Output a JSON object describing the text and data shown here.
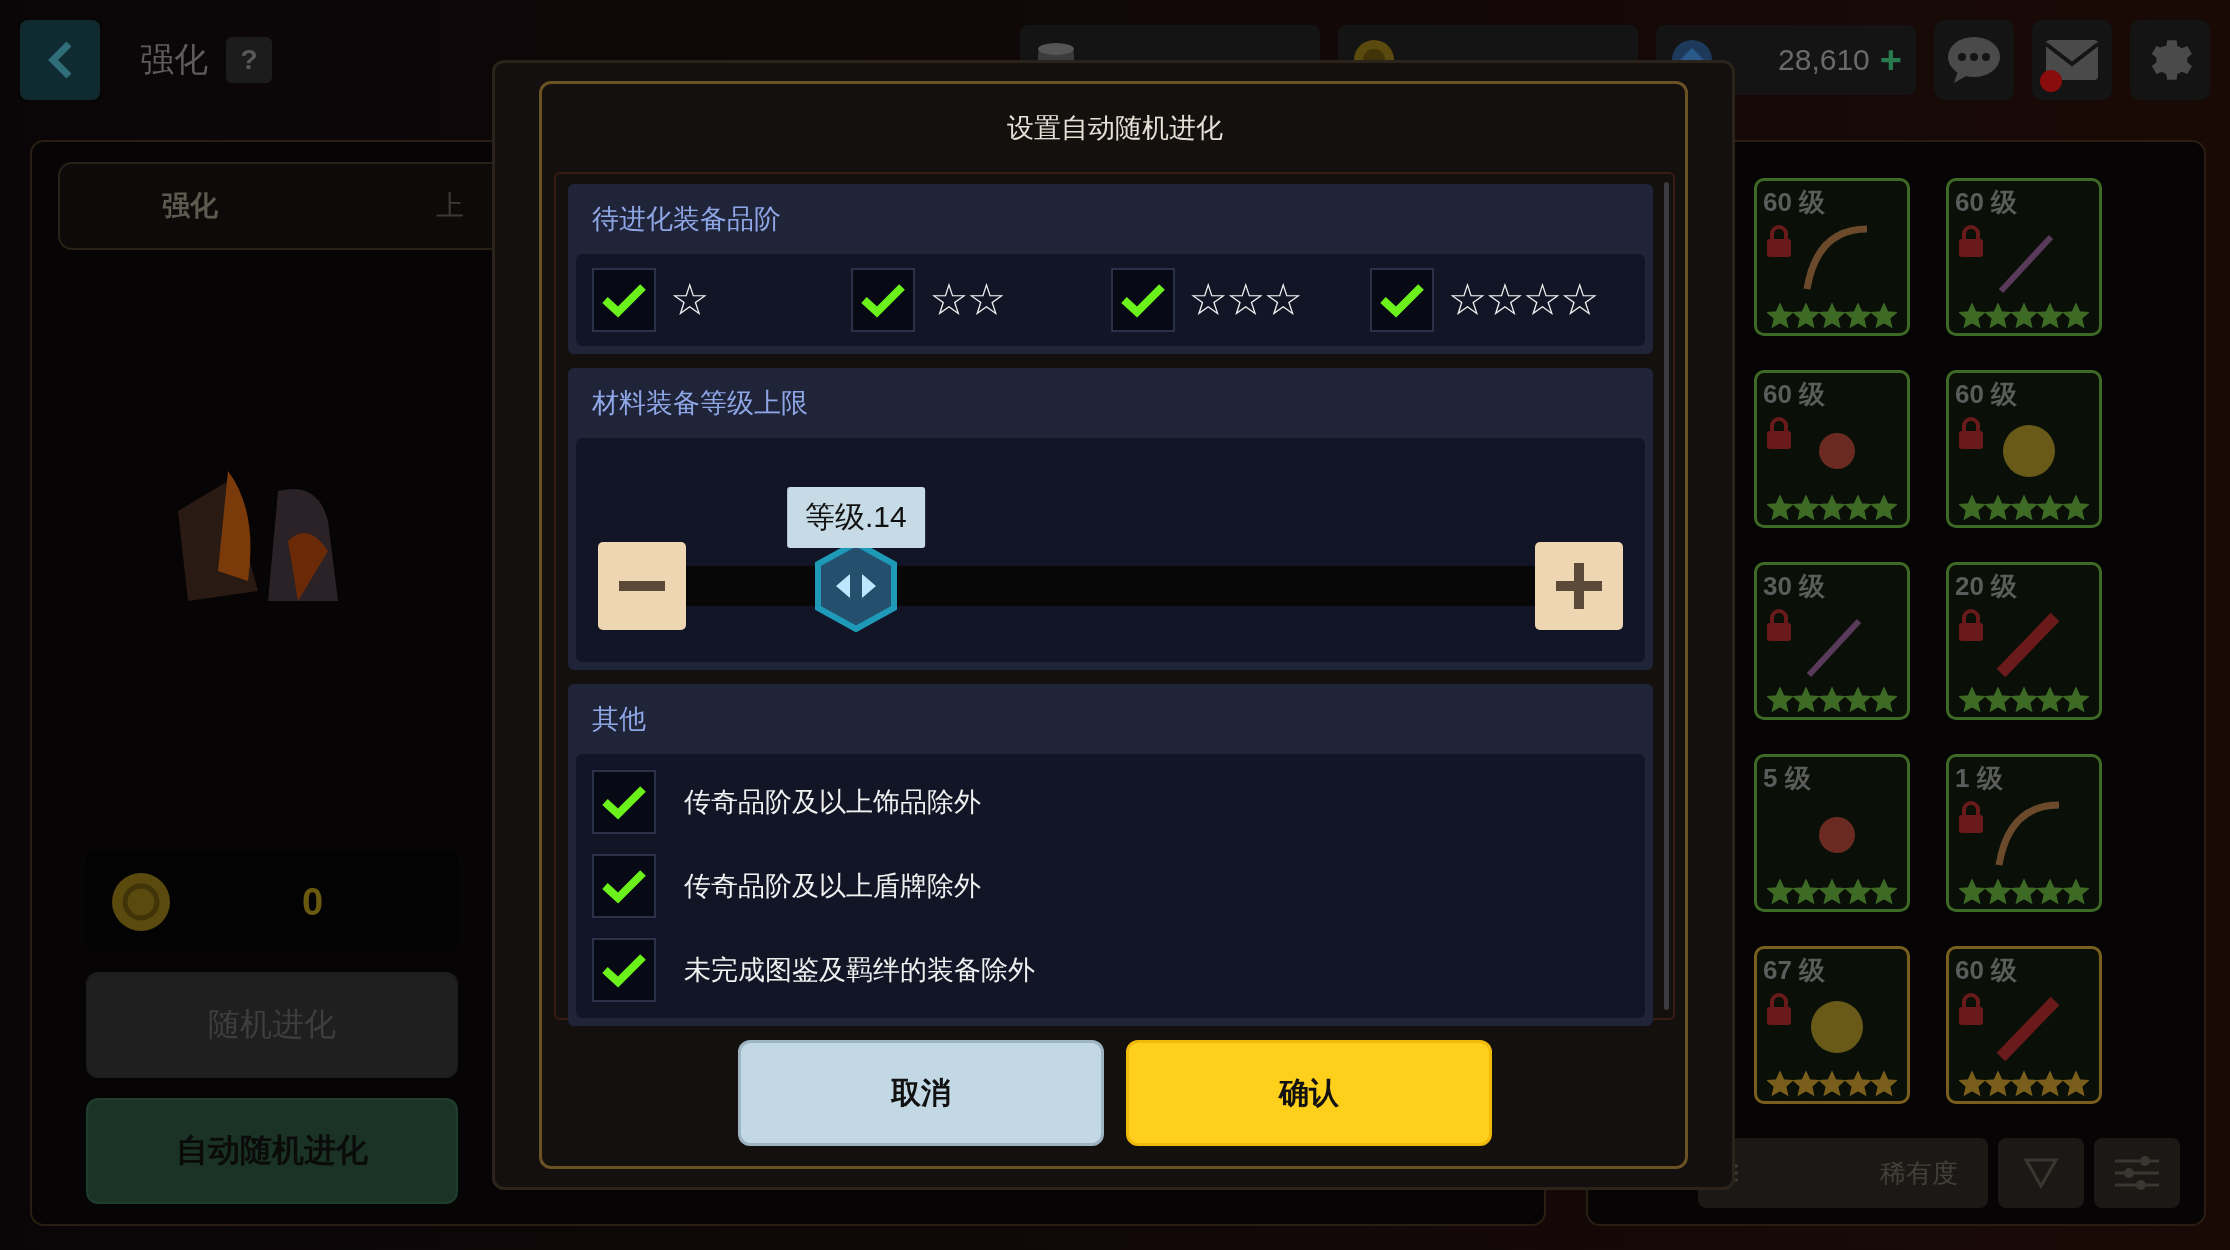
{
  "top_bar": {
    "title": "强化",
    "help": "?",
    "resources": [
      {
        "kind": "scroll"
      },
      {
        "kind": "coin"
      },
      {
        "kind": "gem",
        "value": "28,610",
        "add": "+"
      }
    ],
    "mail_unread": true
  },
  "left_panel": {
    "tabs": [
      {
        "label": "强化",
        "selected": true
      },
      {
        "label": "上",
        "selected": false
      }
    ],
    "cost": "0",
    "buttons": [
      {
        "label": "随机进化",
        "disabled": true
      },
      {
        "label": "自动随机进化",
        "disabled": false
      }
    ]
  },
  "inventory": {
    "items": [
      {
        "level": "60 级",
        "locked": true,
        "color": "#3d6a24",
        "kind": "bow"
      },
      {
        "level": "60 级",
        "locked": true,
        "color": "#3d6a24",
        "kind": "staff"
      },
      {
        "level": "60 级",
        "locked": true,
        "color": "#3d6a24",
        "kind": "flower"
      },
      {
        "level": "60 级",
        "locked": true,
        "color": "#3d6a24",
        "kind": "cat"
      },
      {
        "level": "30 级",
        "locked": true,
        "color": "#3d6a24",
        "kind": "staff"
      },
      {
        "level": "20 级",
        "locked": true,
        "color": "#3d6a24",
        "kind": "sword"
      },
      {
        "level": "5 级",
        "locked": false,
        "color": "#3d6a24",
        "kind": "flower"
      },
      {
        "level": "1 级",
        "locked": true,
        "color": "#3d6a24",
        "kind": "bow"
      },
      {
        "level": "67 级",
        "locked": true,
        "color": "#7a5e1c",
        "kind": "cat"
      },
      {
        "level": "60 级",
        "locked": true,
        "color": "#7a5e1c",
        "kind": "sword"
      }
    ],
    "sort": "稀有度"
  },
  "dialog": {
    "title": "设置自动随机进化",
    "grade": {
      "heading": "待进化装备品阶",
      "options": [
        {
          "checked": true,
          "label": "☆"
        },
        {
          "checked": true,
          "label": "☆☆"
        },
        {
          "checked": true,
          "label": "☆☆☆"
        },
        {
          "checked": true,
          "label": "☆☆☆☆"
        }
      ]
    },
    "level_limit": {
      "heading": "材料装备等级上限",
      "tooltip": "等级.14",
      "level": 0.2
    },
    "other": {
      "heading": "其他",
      "options": [
        {
          "label": "传奇品阶及以上饰品除外",
          "checked": true
        },
        {
          "label": "传奇品阶及以上盾牌除外",
          "checked": true
        },
        {
          "label": "未完成图鉴及羁绊的装备除外",
          "checked": true
        }
      ]
    },
    "buttons": [
      {
        "kind": "cancel",
        "label": "取消"
      },
      {
        "kind": "confirm",
        "label": "确认"
      }
    ]
  }
}
